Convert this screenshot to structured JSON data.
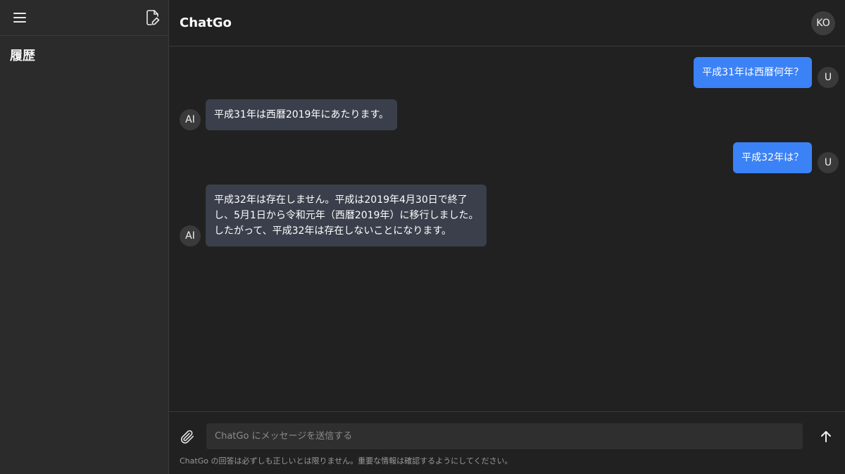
{
  "sidebar": {
    "menu_icon": "hamburger-menu-icon",
    "new_chat_icon": "new-document-edit-icon",
    "title": "履歴"
  },
  "header": {
    "title": "ChatGo",
    "avatar_initials": "KO"
  },
  "messages": [
    {
      "role": "user",
      "avatar": "U",
      "text": "平成31年は西暦何年？"
    },
    {
      "role": "ai",
      "avatar": "AI",
      "text": "平成31年は西暦2019年にあたります。"
    },
    {
      "role": "user",
      "avatar": "U",
      "text": "平成32年は？"
    },
    {
      "role": "ai",
      "avatar": "AI",
      "text": "平成32年は存在しません。平成は2019年4月30日で終了\nし、5月1日から令和元年（西暦2019年）に移行しました。\nしたがって、平成32年は存在しないことになります。"
    }
  ],
  "composer": {
    "attach_icon": "paperclip-icon",
    "placeholder": "ChatGo にメッセージを送信する",
    "value": "",
    "send_icon": "arrow-up-icon",
    "disclaimer": "ChatGo の回答は必ずしも正しいとは限りません。重要な情報は確認するようにしてください。"
  },
  "colors": {
    "background": "#212121",
    "sidebar": "#2b2b2b",
    "user_bubble": "#3b82f6",
    "ai_bubble": "#3a3f4b"
  }
}
